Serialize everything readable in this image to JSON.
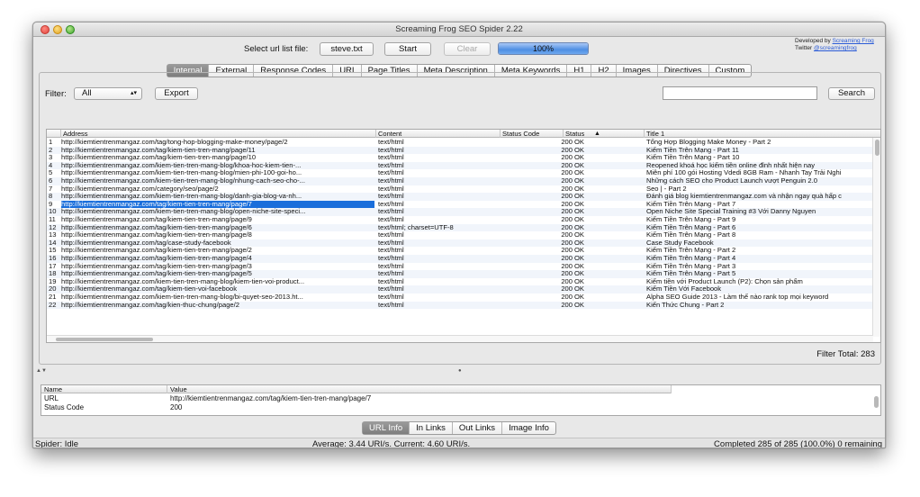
{
  "window": {
    "title": "Screaming Frog SEO Spider 2.22"
  },
  "toolbar": {
    "select_label": "Select url list file:",
    "file_button": "steve.txt",
    "start_button": "Start",
    "clear_button": "Clear",
    "progress_text": "100%",
    "progress_fraction": 1.0
  },
  "developer": {
    "line1": "Developed by",
    "link1": "Screaming Frog",
    "line2": "Twitter",
    "link2": "@screamingfrog"
  },
  "tabs": [
    {
      "label": "Internal",
      "active": true
    },
    {
      "label": "External",
      "active": false
    },
    {
      "label": "Response Codes",
      "active": false
    },
    {
      "label": "URI",
      "active": false
    },
    {
      "label": "Page Titles",
      "active": false
    },
    {
      "label": "Meta Description",
      "active": false
    },
    {
      "label": "Meta Keywords",
      "active": false
    },
    {
      "label": "H1",
      "active": false
    },
    {
      "label": "H2",
      "active": false
    },
    {
      "label": "Images",
      "active": false
    },
    {
      "label": "Directives",
      "active": false
    },
    {
      "label": "Custom",
      "active": false
    }
  ],
  "filter": {
    "label": "Filter:",
    "value": "All",
    "export_button": "Export",
    "search_button": "Search",
    "search_value": ""
  },
  "table": {
    "columns": [
      "Address",
      "Content",
      "Status Code",
      "Status",
      "Title 1"
    ],
    "sort_indicator": "▲",
    "selected_index": 8,
    "rows": [
      {
        "n": "1",
        "address": "http://kiemtientrenmangaz.com/tag/tong-hop-blogging-make-money/page/2",
        "content": "text/html",
        "code": "200",
        "status": "OK",
        "title": "Tổng Hợp Blogging Make Money - Part 2"
      },
      {
        "n": "2",
        "address": "http://kiemtientrenmangaz.com/tag/kiem-tien-tren-mang/page/11",
        "content": "text/html",
        "code": "200",
        "status": "OK",
        "title": "Kiếm Tiền Trên Mạng - Part 11"
      },
      {
        "n": "3",
        "address": "http://kiemtientrenmangaz.com/tag/kiem-tien-tren-mang/page/10",
        "content": "text/html",
        "code": "200",
        "status": "OK",
        "title": "Kiếm Tiền Trên Mạng - Part 10"
      },
      {
        "n": "4",
        "address": "http://kiemtientrenmangaz.com/kiem-tien-tren-mang-blog/khoa-hoc-kiem-tien-...",
        "content": "text/html",
        "code": "200",
        "status": "OK",
        "title": "Reopened khoá học kiếm tiền online đỉnh nhất hiện nay"
      },
      {
        "n": "5",
        "address": "http://kiemtientrenmangaz.com/kiem-tien-tren-mang-blog/mien-phi-100-goi-ho...",
        "content": "text/html",
        "code": "200",
        "status": "OK",
        "title": "Miễn phí 100 gói Hosting Vdedi 8GB Ram - Nhanh Tay Trải Nghi"
      },
      {
        "n": "6",
        "address": "http://kiemtientrenmangaz.com/kiem-tien-tren-mang-blog/nhung-cach-seo-cho-...",
        "content": "text/html",
        "code": "200",
        "status": "OK",
        "title": "Những cách SEO cho Product Launch vượt Penguin 2.0"
      },
      {
        "n": "7",
        "address": "http://kiemtientrenmangaz.com/category/seo/page/2",
        "content": "text/html",
        "code": "200",
        "status": "OK",
        "title": "Seo | - Part 2"
      },
      {
        "n": "8",
        "address": "http://kiemtientrenmangaz.com/kiem-tien-tren-mang-blog/danh-gia-blog-va-nh...",
        "content": "text/html",
        "code": "200",
        "status": "OK",
        "title": "Đánh giá blog kiemtientrenmangaz.com và nhận ngay quà hấp c"
      },
      {
        "n": "9",
        "address": "http://kiemtientrenmangaz.com/tag/kiem-tien-tren-mang/page/7",
        "content": "text/html",
        "code": "200",
        "status": "OK",
        "title": "Kiếm Tiền Trên Mạng - Part 7"
      },
      {
        "n": "10",
        "address": "http://kiemtientrenmangaz.com/kiem-tien-tren-mang-blog/open-niche-site-speci...",
        "content": "text/html",
        "code": "200",
        "status": "OK",
        "title": "Open Niche Site Special Training #3 Với Danny Nguyen"
      },
      {
        "n": "11",
        "address": "http://kiemtientrenmangaz.com/tag/kiem-tien-tren-mang/page/9",
        "content": "text/html",
        "code": "200",
        "status": "OK",
        "title": "Kiếm Tiền Trên Mạng - Part 9"
      },
      {
        "n": "12",
        "address": "http://kiemtientrenmangaz.com/tag/kiem-tien-tren-mang/page/6",
        "content": "text/html; charset=UTF-8",
        "code": "200",
        "status": "OK",
        "title": "Kiếm Tiền Trên Mạng - Part 6"
      },
      {
        "n": "13",
        "address": "http://kiemtientrenmangaz.com/tag/kiem-tien-tren-mang/page/8",
        "content": "text/html",
        "code": "200",
        "status": "OK",
        "title": "Kiếm Tiền Trên Mạng - Part 8"
      },
      {
        "n": "14",
        "address": "http://kiemtientrenmangaz.com/tag/case-study-facebook",
        "content": "text/html",
        "code": "200",
        "status": "OK",
        "title": "Case Study Facebook"
      },
      {
        "n": "15",
        "address": "http://kiemtientrenmangaz.com/tag/kiem-tien-tren-mang/page/2",
        "content": "text/html",
        "code": "200",
        "status": "OK",
        "title": "Kiếm Tiền Trên Mạng - Part 2"
      },
      {
        "n": "16",
        "address": "http://kiemtientrenmangaz.com/tag/kiem-tien-tren-mang/page/4",
        "content": "text/html",
        "code": "200",
        "status": "OK",
        "title": "Kiếm Tiền Trên Mạng - Part 4"
      },
      {
        "n": "17",
        "address": "http://kiemtientrenmangaz.com/tag/kiem-tien-tren-mang/page/3",
        "content": "text/html",
        "code": "200",
        "status": "OK",
        "title": "Kiếm Tiền Trên Mạng - Part 3"
      },
      {
        "n": "18",
        "address": "http://kiemtientrenmangaz.com/tag/kiem-tien-tren-mang/page/5",
        "content": "text/html",
        "code": "200",
        "status": "OK",
        "title": "Kiếm Tiền Trên Mạng - Part 5"
      },
      {
        "n": "19",
        "address": "http://kiemtientrenmangaz.com/kiem-tien-tren-mang-blog/kiem-tien-voi-product...",
        "content": "text/html",
        "code": "200",
        "status": "OK",
        "title": "Kiếm tiền với Product Launch (P2): Chọn sản phẩm"
      },
      {
        "n": "20",
        "address": "http://kiemtientrenmangaz.com/tag/kiem-tien-voi-facebook",
        "content": "text/html",
        "code": "200",
        "status": "OK",
        "title": "Kiếm Tiền Với Facebook"
      },
      {
        "n": "21",
        "address": "http://kiemtientrenmangaz.com/kiem-tien-tren-mang-blog/bi-quyet-seo-2013.ht...",
        "content": "text/html",
        "code": "200",
        "status": "OK",
        "title": "Alpha SEO Guide 2013 - Làm thế nào rank top mọi keyword"
      },
      {
        "n": "22",
        "address": "http://kiemtientrenmangaz.com/tag/kien-thuc-chung/page/2",
        "content": "text/html",
        "code": "200",
        "status": "OK",
        "title": "Kiến Thức Chung - Part 2"
      }
    ]
  },
  "filter_total": "Filter Total:  283",
  "details": {
    "columns": [
      "Name",
      "Value"
    ],
    "rows": [
      {
        "name": "URL",
        "value": "http://kiemtientrenmangaz.com/tag/kiem-tien-tren-mang/page/7"
      },
      {
        "name": "Status Code",
        "value": "200"
      }
    ]
  },
  "bottom_tabs": [
    {
      "label": "URL Info",
      "active": true
    },
    {
      "label": "In Links",
      "active": false
    },
    {
      "label": "Out Links",
      "active": false
    },
    {
      "label": "Image Info",
      "active": false
    }
  ],
  "statusbar": {
    "left": "Spider: Idle",
    "middle": "Average: 3.44 URI/s. Current: 4.60 URI/s.",
    "right": "Completed 285 of 285 (100.0%) 0 remaining"
  },
  "icons": {
    "sort": "sort-ascending-icon",
    "select_arrows": "updown-arrows-icon"
  }
}
